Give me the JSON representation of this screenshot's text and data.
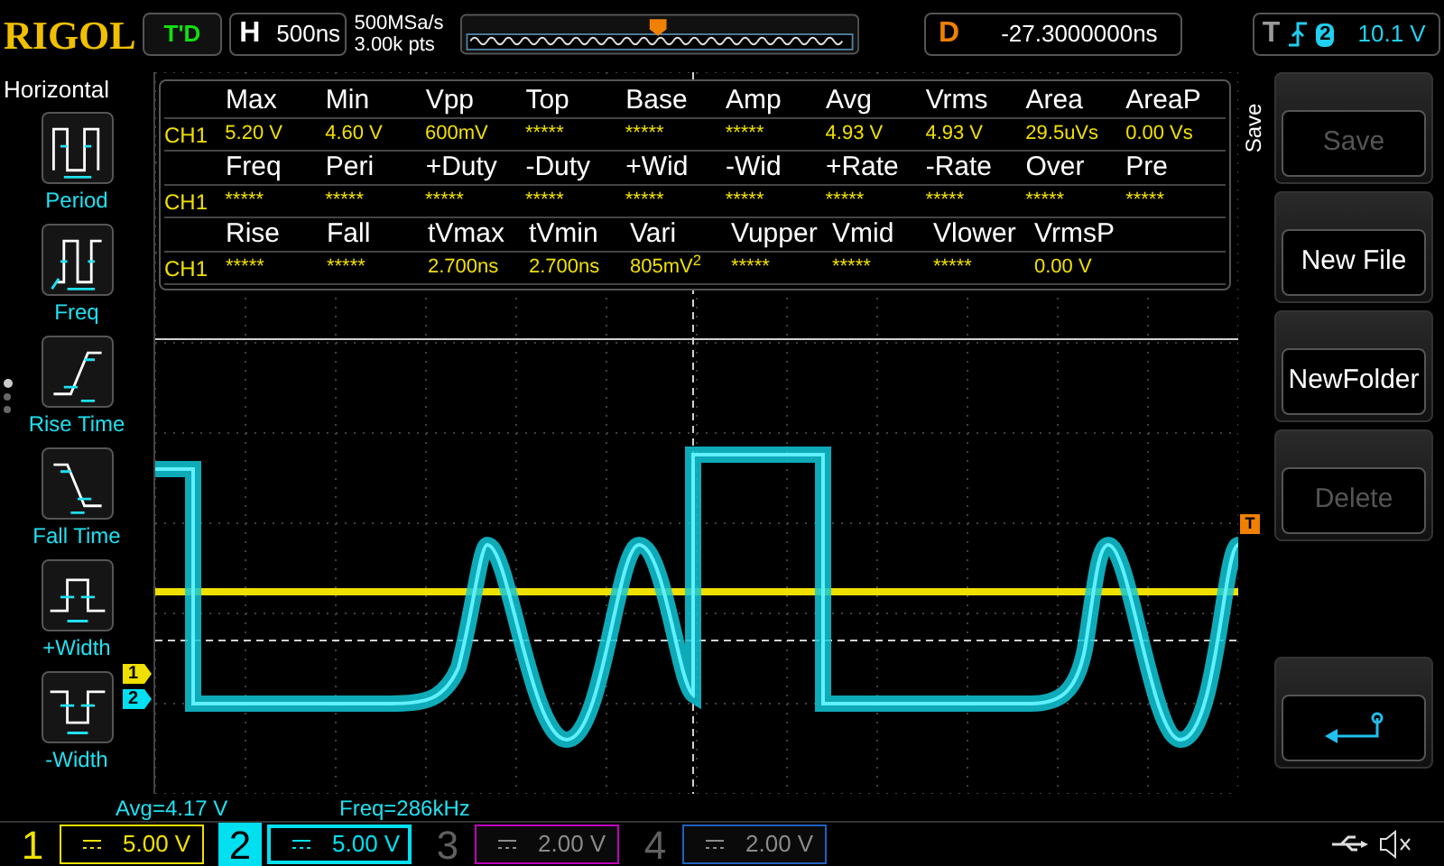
{
  "top_bar": {
    "logo": "RIGOL",
    "run_status": "T'D",
    "timebase": {
      "label": "H",
      "value": "500ns"
    },
    "sample_rate": "500MSa/s",
    "memory_depth": "3.00k pts",
    "delay": {
      "label": "D",
      "value": "-27.3000000ns"
    },
    "trigger": {
      "label": "T",
      "source": "2",
      "level": "10.1 V"
    }
  },
  "left_menu": {
    "title": "Horizontal",
    "pages": [
      {
        "selected": true
      },
      {
        "selected": false
      },
      {
        "selected": false
      }
    ],
    "items": [
      {
        "kind": "period",
        "label": "Period"
      },
      {
        "kind": "freq",
        "label": "Freq"
      },
      {
        "kind": "rise",
        "label": "Rise Time"
      },
      {
        "kind": "fall",
        "label": "Fall Time"
      },
      {
        "kind": "pwidth",
        "label": "+Width"
      },
      {
        "kind": "nwidth",
        "label": "-Width"
      }
    ]
  },
  "measurements": [
    {
      "channel": "CH1",
      "items": [
        {
          "label": "Max",
          "value": "5.20 V"
        },
        {
          "label": "Min",
          "value": "4.60 V"
        },
        {
          "label": "Vpp",
          "value": "600mV"
        },
        {
          "label": "Top",
          "value": "*****"
        },
        {
          "label": "Base",
          "value": "*****"
        },
        {
          "label": "Amp",
          "value": "*****"
        },
        {
          "label": "Avg",
          "value": "4.93 V"
        },
        {
          "label": "Vrms",
          "value": "4.93 V"
        },
        {
          "label": "Area",
          "value": "29.5uVs"
        },
        {
          "label": "AreaP",
          "value": "0.00 Vs"
        }
      ]
    },
    {
      "channel": "CH1",
      "items": [
        {
          "label": "Freq",
          "value": "*****"
        },
        {
          "label": "Peri",
          "value": "*****"
        },
        {
          "label": "+Duty",
          "value": "*****"
        },
        {
          "label": "-Duty",
          "value": "*****"
        },
        {
          "label": "+Wid",
          "value": "*****"
        },
        {
          "label": "-Wid",
          "value": "*****"
        },
        {
          "label": "+Rate",
          "value": "*****"
        },
        {
          "label": "-Rate",
          "value": "*****"
        },
        {
          "label": "Over",
          "value": "*****"
        },
        {
          "label": "Pre",
          "value": "*****"
        }
      ]
    },
    {
      "channel": "CH1",
      "items": [
        {
          "label": "Rise",
          "value": "*****"
        },
        {
          "label": "Fall",
          "value": "*****"
        },
        {
          "label": "tVmax",
          "value": "2.700ns"
        },
        {
          "label": "tVmin",
          "value": "2.700ns"
        },
        {
          "label": "Vari",
          "value": "805mV$^{2}$",
          "kind": "markup"
        },
        {
          "label": "Vupper",
          "value": "*****"
        },
        {
          "label": "Vmid",
          "value": "*****"
        },
        {
          "label": "Vlower",
          "value": "*****"
        },
        {
          "label": "VrmsP",
          "value": "0.00 V"
        }
      ]
    }
  ],
  "channel_markers": [
    {
      "label": "1",
      "color": "#f0e000"
    },
    {
      "label": "2",
      "color": "#00e0f0"
    }
  ],
  "trigger_marker": "T",
  "status_line": {
    "avg": "Avg=4.17 V",
    "freq": "Freq=286kHz"
  },
  "right_menu": {
    "title": "Save",
    "buttons": [
      {
        "kind": "text",
        "label": "Save",
        "disabled": true
      },
      {
        "kind": "text",
        "label": "New File",
        "disabled": false
      },
      {
        "kind": "text",
        "label": "NewFolder",
        "disabled": false
      },
      {
        "kind": "text",
        "label": "Delete",
        "disabled": true
      },
      {
        "kind": "spacer"
      },
      {
        "kind": "back"
      }
    ]
  },
  "channels": [
    {
      "number": "1",
      "scale": "5.00 V",
      "color": "#f0e000",
      "on": true,
      "selected": false
    },
    {
      "number": "2",
      "scale": "5.00 V",
      "color": "#00e0f0",
      "on": true,
      "selected": true
    },
    {
      "number": "3",
      "scale": "2.00 V",
      "color": "#c000c0",
      "on": false,
      "selected": false
    },
    {
      "number": "4",
      "scale": "2.00 V",
      "color": "#2060c0",
      "on": false,
      "selected": false
    }
  ]
}
